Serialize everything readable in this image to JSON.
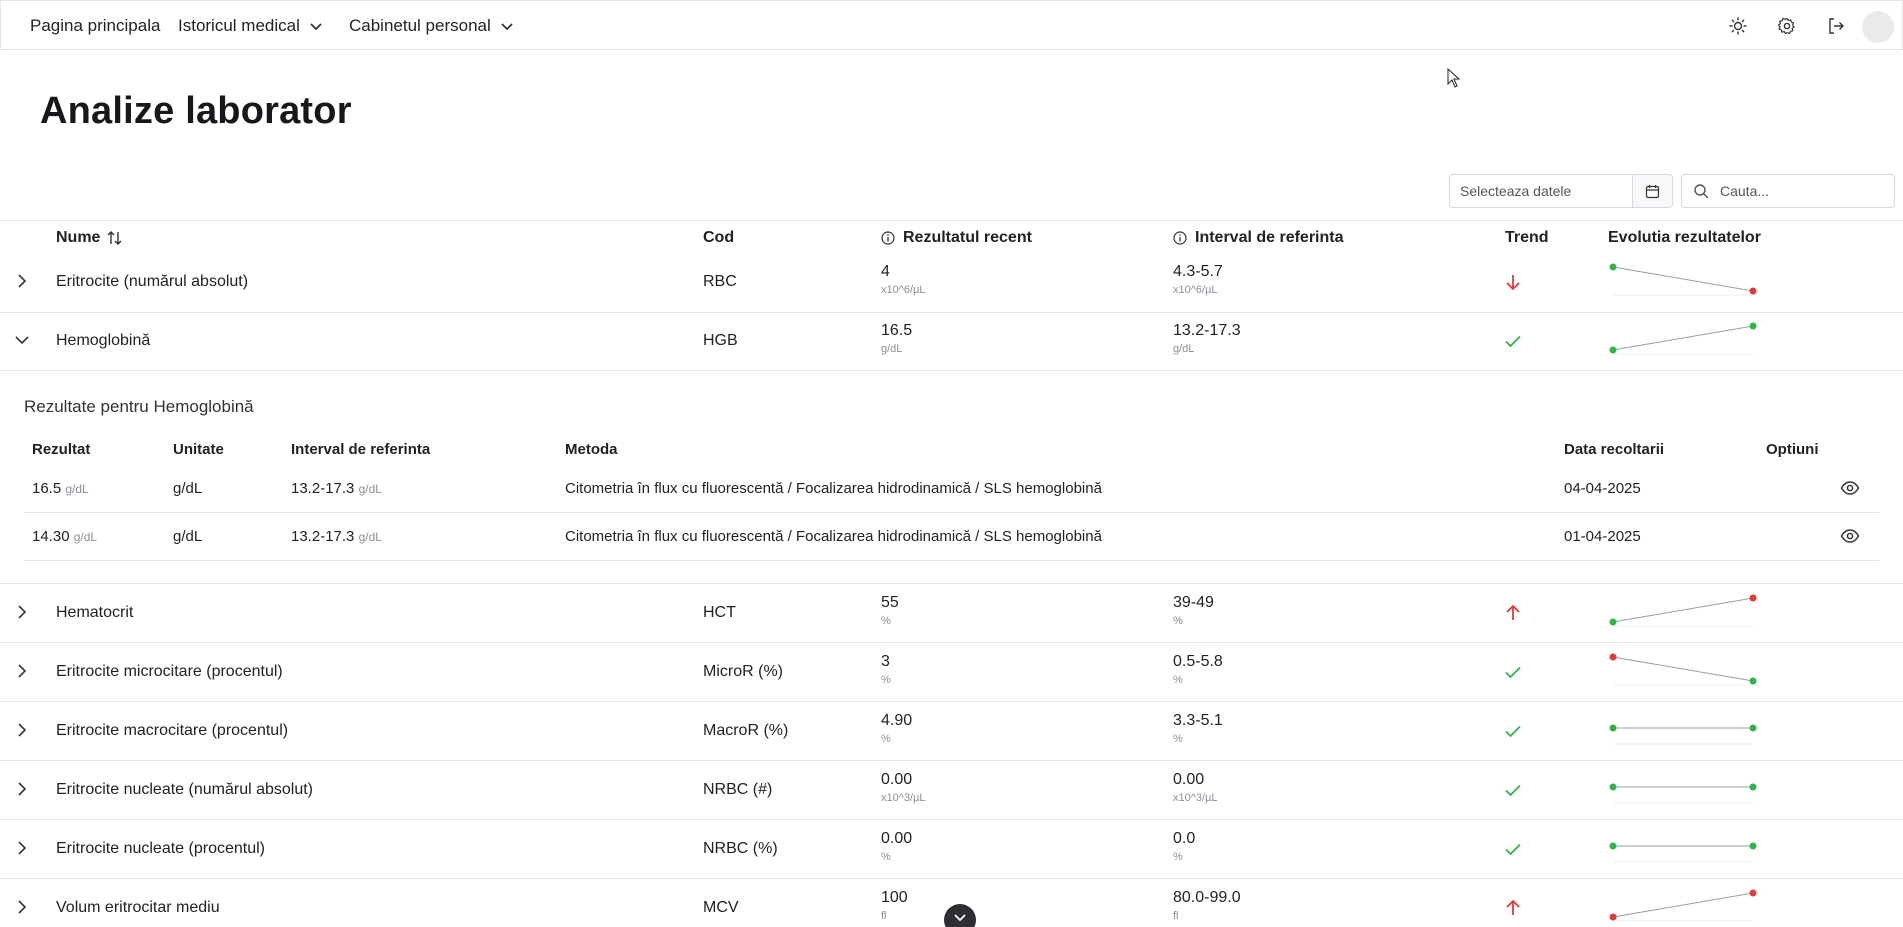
{
  "nav": {
    "home": "Pagina principala",
    "history": "Istoricul medical",
    "cabinet": "Cabinetul personal",
    "icons": [
      "sun-icon",
      "gear-icon",
      "logout-icon"
    ]
  },
  "page": {
    "title": "Analize laborator"
  },
  "filters": {
    "date_placeholder": "Selecteaza datele",
    "search_placeholder": "Cauta..."
  },
  "table": {
    "headers": {
      "name": "Nume",
      "code": "Cod",
      "recent": "Rezultatul recent",
      "ref": "Interval de referinta",
      "trend": "Trend",
      "evolution": "Evolutia rezultatelor"
    },
    "rows": [
      {
        "name": "Eritrocite (numărul absolut)",
        "code": "RBC",
        "value": "4",
        "unit": "x10^6/µL",
        "ref": "4.3-5.7",
        "ref_unit": "x10^6/µL",
        "trend": "down",
        "spark": [
          4.9,
          4.0
        ],
        "spark_status": [
          "normal",
          "abnormal"
        ],
        "expanded": false
      },
      {
        "name": "Hemoglobină",
        "code": "HGB",
        "value": "16.5",
        "unit": "g/dL",
        "ref": "13.2-17.3",
        "ref_unit": "g/dL",
        "trend": "ok",
        "spark": [
          14.3,
          16.5
        ],
        "spark_status": [
          "normal",
          "normal"
        ],
        "expanded": true
      },
      {
        "name": "Hematocrit",
        "code": "HCT",
        "value": "55",
        "unit": "%",
        "ref": "39-49",
        "ref_unit": "%",
        "trend": "up",
        "spark": [
          46,
          55
        ],
        "spark_status": [
          "normal",
          "abnormal"
        ],
        "expanded": false
      },
      {
        "name": "Eritrocite microcitare (procentul)",
        "code": "MicroR (%)",
        "value": "3",
        "unit": "%",
        "ref": "0.5-5.8",
        "ref_unit": "%",
        "trend": "ok",
        "spark": [
          6.5,
          3
        ],
        "spark_status": [
          "abnormal",
          "normal"
        ],
        "expanded": false
      },
      {
        "name": "Eritrocite macrocitare (procentul)",
        "code": "MacroR (%)",
        "value": "4.90",
        "unit": "%",
        "ref": "3.3-5.1",
        "ref_unit": "%",
        "trend": "ok",
        "spark": [
          4.9,
          4.9
        ],
        "spark_status": [
          "normal",
          "normal"
        ],
        "expanded": false
      },
      {
        "name": "Eritrocite nucleate (numărul absolut)",
        "code": "NRBC (#)",
        "value": "0.00",
        "unit": "x10^3/µL",
        "ref": "0.00",
        "ref_unit": "x10^3/µL",
        "trend": "ok",
        "spark": [
          0,
          0
        ],
        "spark_status": [
          "normal",
          "normal"
        ],
        "expanded": false
      },
      {
        "name": "Eritrocite nucleate (procentul)",
        "code": "NRBC (%)",
        "value": "0.00",
        "unit": "%",
        "ref": "0.0",
        "ref_unit": "%",
        "trend": "ok",
        "spark": [
          0,
          0
        ],
        "spark_status": [
          "normal",
          "normal"
        ],
        "expanded": false
      },
      {
        "name": "Volum eritrocitar mediu",
        "code": "MCV",
        "value": "100",
        "unit": "fl",
        "ref": "80.0-99.0",
        "ref_unit": "fl",
        "trend": "up",
        "spark": [
          92,
          100
        ],
        "spark_status": [
          "abnormal",
          "abnormal"
        ],
        "expanded": false
      }
    ]
  },
  "details": {
    "title": "Rezultate pentru Hemoglobină",
    "headers": {
      "result": "Rezultat",
      "unit": "Unitate",
      "ref": "Interval de referinta",
      "method": "Metoda",
      "date": "Data recoltarii",
      "options": "Optiuni"
    },
    "rows": [
      {
        "result": "16.5",
        "result_unit": "g/dL",
        "unit": "g/dL",
        "ref": "13.2-17.3",
        "ref_unit": "g/dL",
        "method": "Citometria în flux cu fluorescentă / Focalizarea hidrodinamică / SLS hemoglobină",
        "date": "04-04-2025"
      },
      {
        "result": "14.30",
        "result_unit": "g/dL",
        "unit": "g/dL",
        "ref": "13.2-17.3",
        "ref_unit": "g/dL",
        "method": "Citometria în flux cu fluorescentă / Focalizarea hidrodinamică / SLS hemoglobină",
        "date": "01-04-2025"
      }
    ]
  },
  "colors": {
    "ok": "#2fb34a",
    "alert": "#e03a3a",
    "line": "#9aa0a6"
  }
}
